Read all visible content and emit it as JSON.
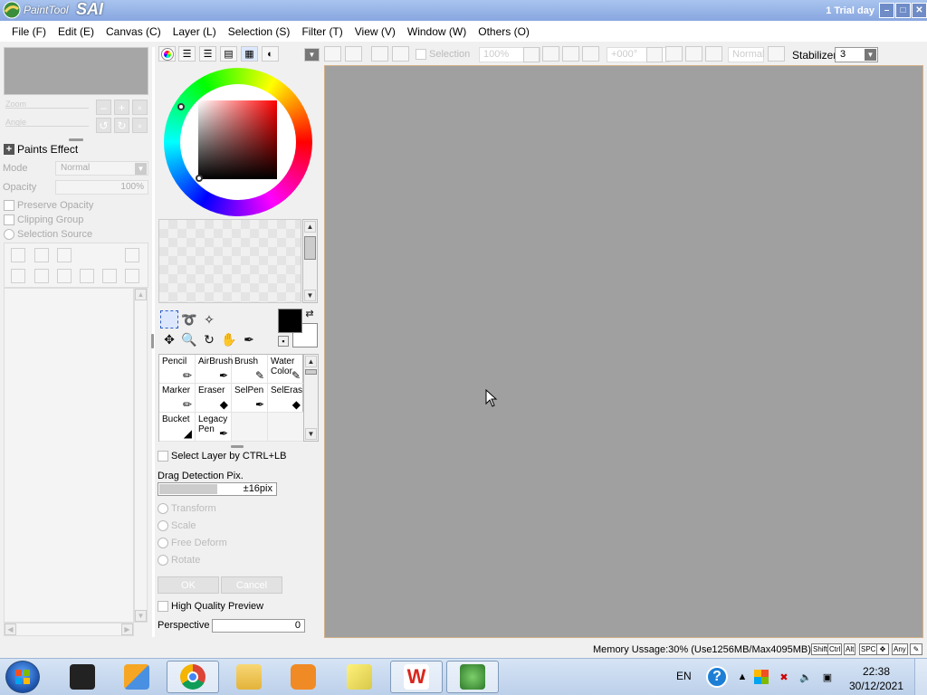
{
  "window": {
    "app_logo_small": "PaintTool",
    "app_logo_big": "SAI",
    "trial_label": "1 Trial day",
    "minimize": "–",
    "maximize": "□",
    "close": "✕"
  },
  "menu": [
    "File (F)",
    "Edit (E)",
    "Canvas (C)",
    "Layer (L)",
    "Selection (S)",
    "Filter (T)",
    "View (V)",
    "Window (W)",
    "Others (O)"
  ],
  "navigator": {
    "zoom_label": "Zoom",
    "angle_label": "Angle"
  },
  "layer_props": {
    "paints_effect": "Paints Effect",
    "mode_label": "Mode",
    "mode_value": "Normal",
    "opacity_label": "Opacity",
    "opacity_value": "100%",
    "preserve_opacity": "Preserve Opacity",
    "clipping_group": "Clipping Group",
    "selection_source": "Selection Source"
  },
  "toolbar": {
    "selection_label": "Selection",
    "zoom_value": "100%",
    "angle_value": "+000°",
    "blend_value": "Normal",
    "stabilizer_label": "Stabilizer",
    "stabilizer_value": "3"
  },
  "brushes": [
    {
      "label": "Pencil",
      "icon": "pencil-icon",
      "glyph": "✏"
    },
    {
      "label": "AirBrush",
      "icon": "airbrush-icon",
      "glyph": "✒"
    },
    {
      "label": "Brush",
      "icon": "brush-icon",
      "glyph": "🖌"
    },
    {
      "label": "Water Color",
      "icon": "watercolor-icon",
      "glyph": "🖌"
    },
    {
      "label": "Marker",
      "icon": "marker-icon",
      "glyph": "✏"
    },
    {
      "label": "Eraser",
      "icon": "eraser-icon",
      "glyph": "◆"
    },
    {
      "label": "SelPen",
      "icon": "selpen-icon",
      "glyph": "✒"
    },
    {
      "label": "SelEras",
      "icon": "seleras-icon",
      "glyph": "◆"
    },
    {
      "label": "Bucket",
      "icon": "bucket-icon",
      "glyph": "▼"
    },
    {
      "label": "Legacy Pen",
      "icon": "legacy-pen-icon",
      "glyph": "✒"
    }
  ],
  "options": {
    "select_layer": "Select Layer by CTRL+LB",
    "drag_detection_label": "Drag Detection Pix.",
    "drag_detection_value": "±16pix",
    "drag_detection_level": 0.5,
    "transform": "Transform",
    "scale": "Scale",
    "free_deform": "Free Deform",
    "rotate": "Rotate",
    "ok": "OK",
    "cancel": "Cancel",
    "high_quality_preview": "High Quality Preview",
    "perspective_label": "Perspective",
    "perspective_value": "0"
  },
  "status": {
    "memory_usage": "Memory Ussage:30% (Use1256MB/Max4095MB)",
    "keys": [
      "Shift",
      "Ctrl",
      "Alt",
      "SPC",
      "Any"
    ]
  },
  "taskbar": {
    "language": "EN",
    "time": "22:38",
    "date": "30/12/2021"
  },
  "colors": {
    "foreground": "#000000",
    "background": "#ffffff",
    "canvas_bg": "#a0a0a0"
  }
}
